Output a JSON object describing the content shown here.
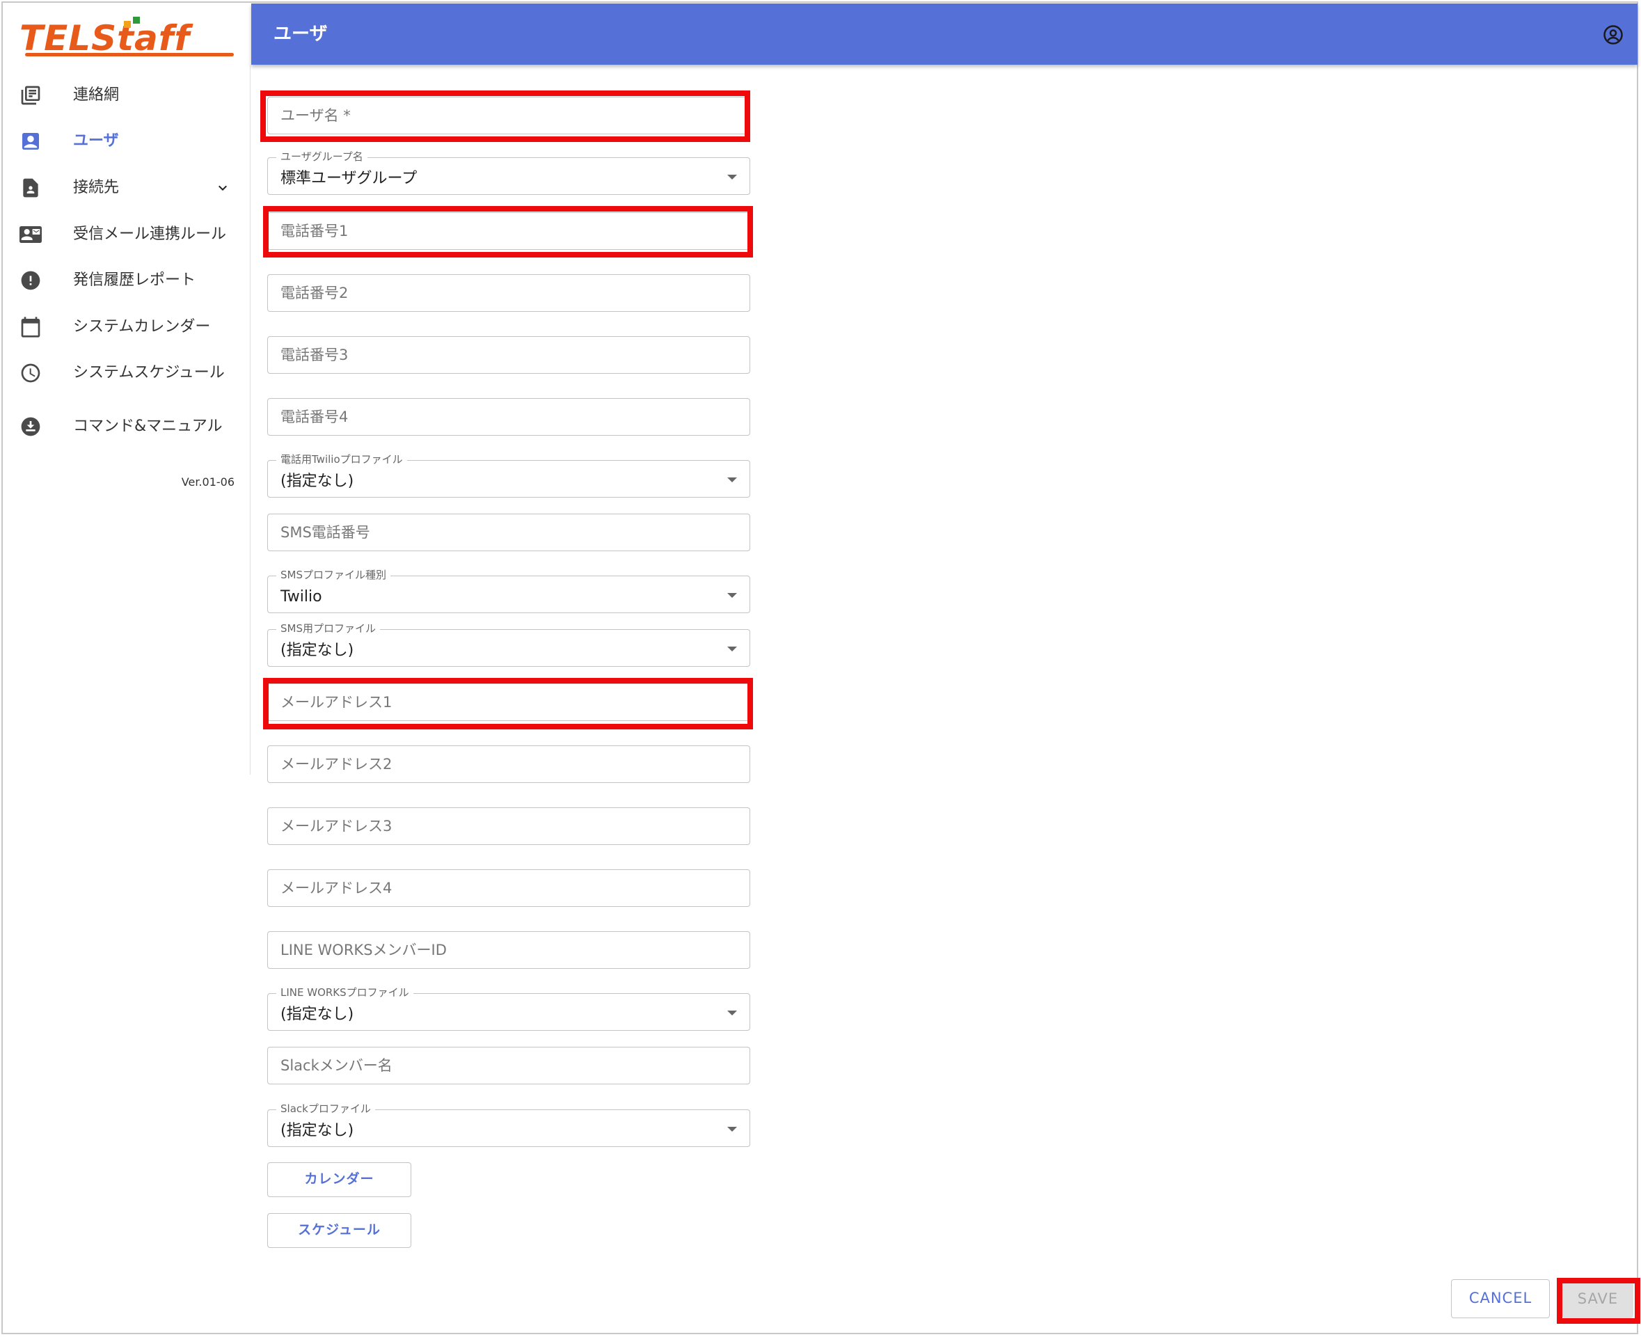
{
  "app": {
    "logo_text": "TELStaff",
    "page_title": "ユーザ",
    "version": "Ver.01-06"
  },
  "sidebar": {
    "items": [
      {
        "label": "連絡網",
        "icon": "contact-list-icon"
      },
      {
        "label": "ユーザ",
        "icon": "user-badge-icon"
      },
      {
        "label": "接続先",
        "icon": "contact-file-icon"
      },
      {
        "label": "受信メール連携ルール",
        "icon": "contact-mail-icon"
      },
      {
        "label": "発信履歴レポート",
        "icon": "alert-circle-icon"
      },
      {
        "label": "システムカレンダー",
        "icon": "calendar-icon"
      },
      {
        "label": "システムスケジュール",
        "icon": "clock-icon"
      },
      {
        "label": "コマンド&マニュアル",
        "icon": "download-circle-icon"
      }
    ]
  },
  "form": {
    "username_placeholder": "ユーザ名 *",
    "user_group_label": "ユーザグループ名",
    "user_group_value": "標準ユーザグループ",
    "phone1_placeholder": "電話番号1",
    "phone2_placeholder": "電話番号2",
    "phone3_placeholder": "電話番号3",
    "phone4_placeholder": "電話番号4",
    "twilio_phone_label": "電話用Twilioプロファイル",
    "twilio_phone_value": "(指定なし)",
    "sms_phone_placeholder": "SMS電話番号",
    "sms_type_label": "SMSプロファイル種別",
    "sms_type_value": "Twilio",
    "sms_profile_label": "SMS用プロファイル",
    "sms_profile_value": "(指定なし)",
    "email1_placeholder": "メールアドレス1",
    "email2_placeholder": "メールアドレス2",
    "email3_placeholder": "メールアドレス3",
    "email4_placeholder": "メールアドレス4",
    "lineworks_member_placeholder": "LINE WORKSメンバーID",
    "lineworks_profile_label": "LINE WORKSプロファイル",
    "lineworks_profile_value": "(指定なし)",
    "slack_member_placeholder": "Slackメンバー名",
    "slack_profile_label": "Slackプロファイル",
    "slack_profile_value": "(指定なし)",
    "calendar_button": "カレンダー",
    "schedule_button": "スケジュール"
  },
  "actions": {
    "cancel": "CANCEL",
    "save": "SAVE"
  },
  "colors": {
    "accent": "#5570d6",
    "highlight": "#ee0a0a",
    "logo": "#e85a1a"
  }
}
